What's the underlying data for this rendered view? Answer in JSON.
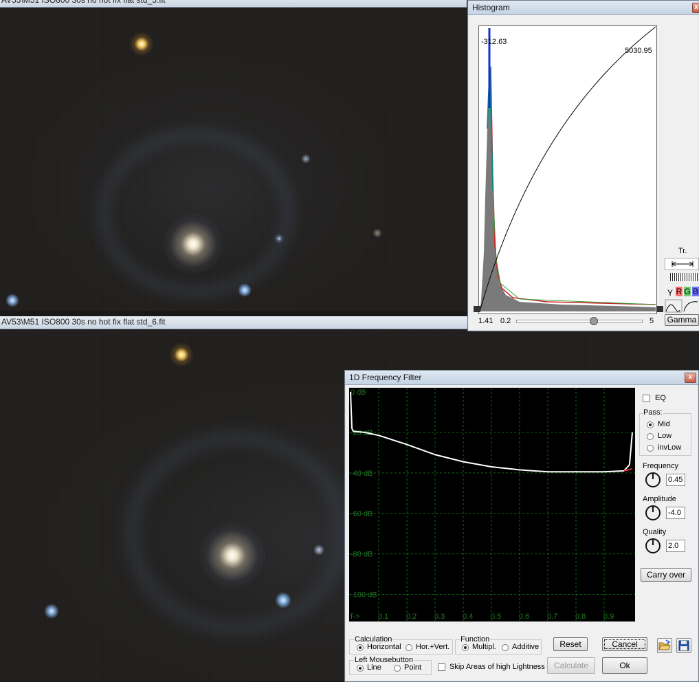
{
  "image_windows": {
    "top_title": "AV53\\M51 ISO800 30s no hot fix flat std_5.fit",
    "bottom_title": "AV53\\M51 ISO800 30s no hot fix flat std_6.fit"
  },
  "histogram": {
    "title": "Histogram",
    "min_label": "-312.63",
    "max_label": "5030.95",
    "gamma_value": "1.41",
    "slider_min": "0.2",
    "slider_max": "5",
    "slider_fraction": 0.62,
    "tr_label": "Tr.",
    "channels": {
      "y": "Y",
      "r": "R",
      "g": "G",
      "b": "B"
    },
    "gamma_button": "Gamma",
    "colors": {
      "r": "#ff7070",
      "g": "#70d070",
      "b": "#7070ff"
    }
  },
  "freq_filter": {
    "title": "1D Frequency Filter",
    "close": "x",
    "eq_label": "EQ",
    "pass": {
      "label": "Pass:",
      "options": [
        "Mid",
        "Low",
        "invLow"
      ],
      "selected": "Mid"
    },
    "frequency": {
      "label": "Frequency",
      "value": "0.45"
    },
    "amplitude": {
      "label": "Amplitude",
      "value": "-4.0"
    },
    "quality": {
      "label": "Quality",
      "value": "2.0"
    },
    "carry_over": "Carry over",
    "calculation": {
      "label": "Calculation",
      "options": [
        "Horizontal",
        "Hor.+Vert."
      ],
      "selected": "Horizontal"
    },
    "function": {
      "label": "Function",
      "options": [
        "Multipl.",
        "Additive"
      ],
      "selected": "Multipl."
    },
    "left_mouse": {
      "label": "Left Mousebutton",
      "options": [
        "Line",
        "Point"
      ],
      "selected": "Line"
    },
    "skip_label": "Skip Areas of high Lightness",
    "reset": "Reset",
    "cancel": "Cancel",
    "calculate": "Calculate",
    "ok": "Ok",
    "chart_data": {
      "type": "line",
      "y_tick_labels": [
        "0 dB",
        "-20 dB",
        "-40 dB",
        "-60 dB",
        "-80 dB",
        "-100 dB"
      ],
      "x_tick_labels": [
        "f->",
        "0.1",
        "0.2",
        "0.3",
        "0.4",
        "0.5",
        "0.6",
        "0.7",
        "0.8",
        "0.9"
      ],
      "ylim": [
        -110,
        0
      ],
      "xlim": [
        0,
        1
      ],
      "grid": true,
      "series": [
        {
          "x": [
            0,
            0.005,
            0.01,
            0.05,
            0.1,
            0.2,
            0.3,
            0.4,
            0.5,
            0.6,
            0.7,
            0.8,
            0.9,
            0.97,
            0.99,
            1.0
          ],
          "y": [
            0,
            -18,
            -19.5,
            -20,
            -21.5,
            -26,
            -31,
            -34.5,
            -37,
            -38.5,
            -39.5,
            -39.5,
            -39.5,
            -39,
            -36,
            -20
          ]
        }
      ]
    }
  }
}
